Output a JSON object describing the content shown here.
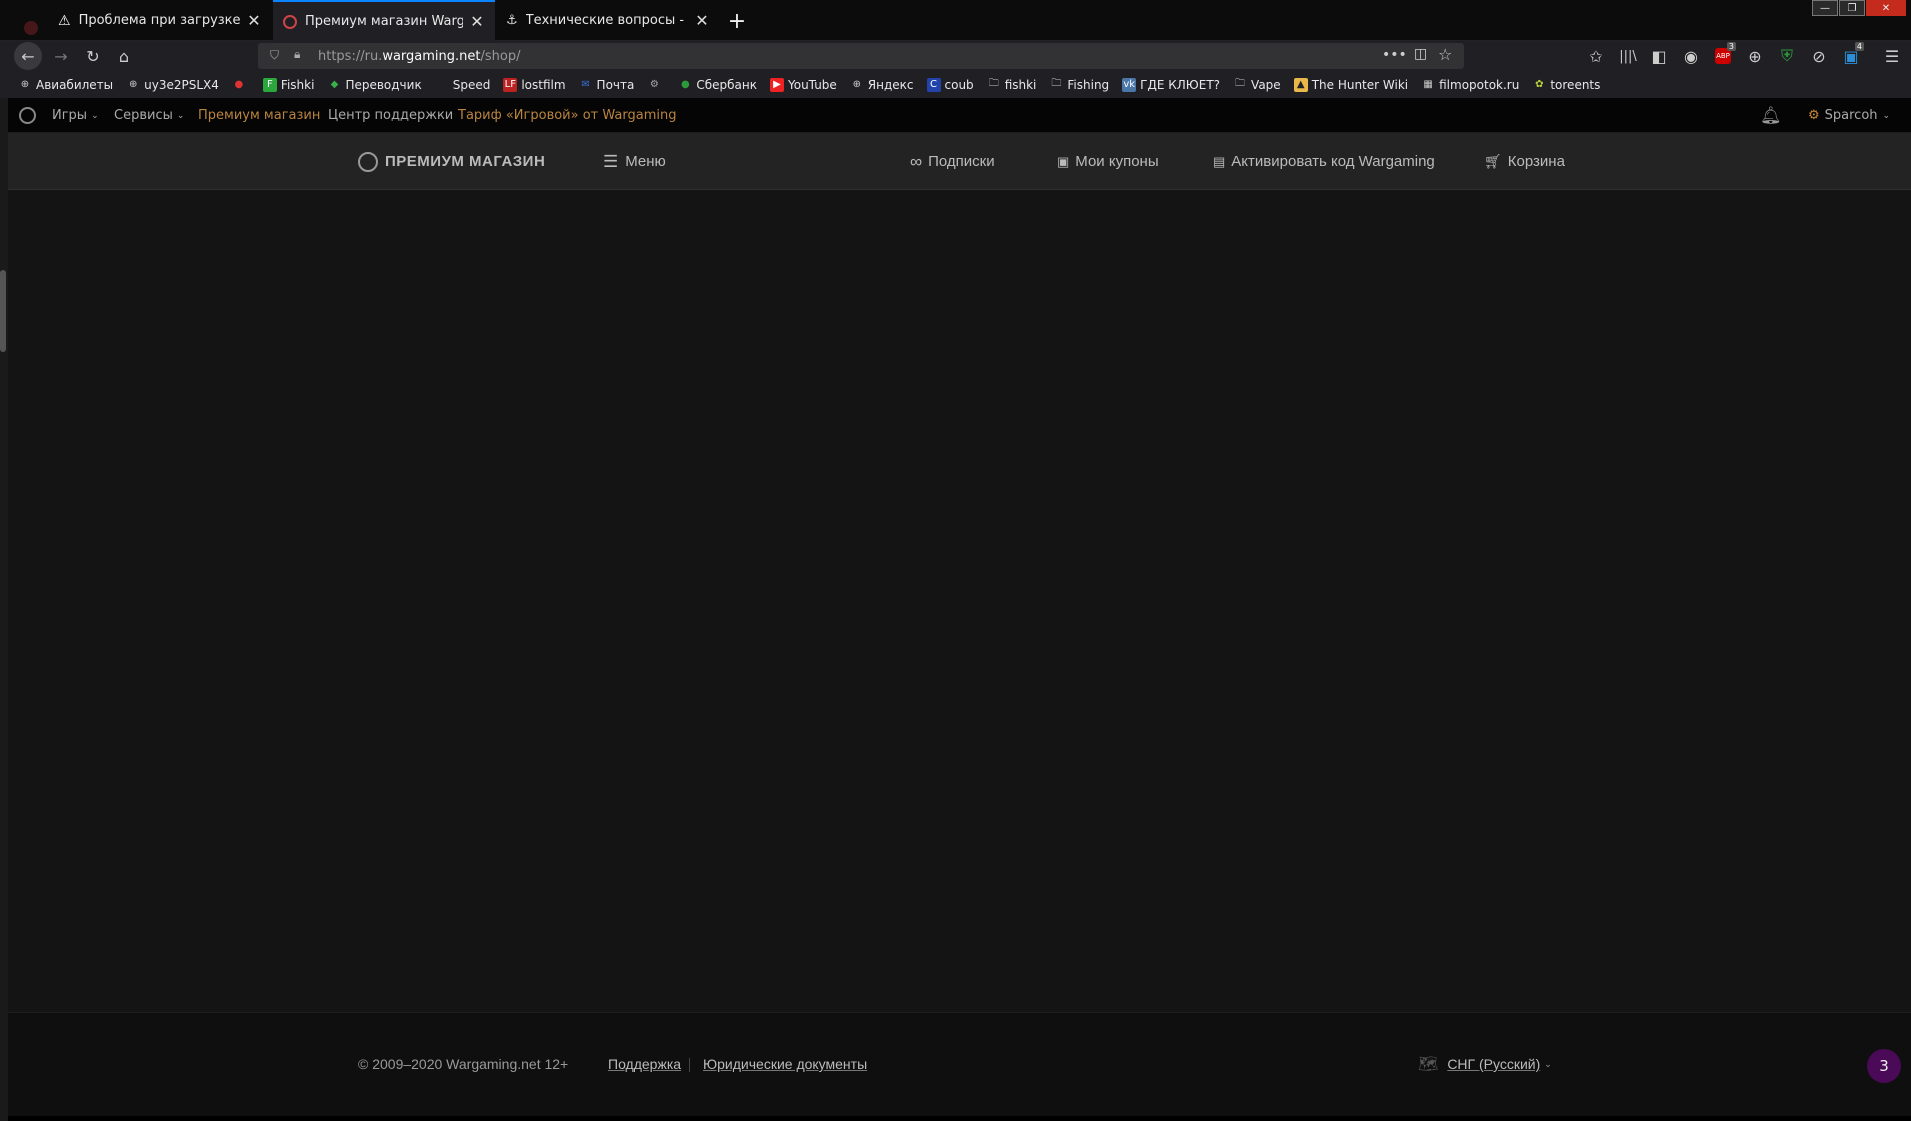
{
  "browser": {
    "tabs": [
      {
        "title": "Проблема при загрузке стра",
        "icon": "warning-icon",
        "active": false
      },
      {
        "title": "Премиум магазин Wargaming",
        "icon": "wargaming-logo-icon",
        "active": true
      },
      {
        "title": "Технические вопросы - Офи",
        "icon": "warships-icon",
        "active": false
      }
    ],
    "new_tab": "+",
    "url_prefix": "https://ru.",
    "url_domain": "wargaming.net",
    "url_path": "/shop/",
    "toolbar_badges": {
      "abp": "3",
      "ext": "4"
    },
    "bookmarks": [
      {
        "label": "Авиабилеты",
        "icon": "globe-icon"
      },
      {
        "label": "uy3e2PSLX4",
        "icon": "globe-icon"
      },
      {
        "label": "",
        "icon": "russia-flag-icon"
      },
      {
        "label": "Fishki",
        "icon": "fishki-icon"
      },
      {
        "label": "Переводчик",
        "icon": "translate-icon"
      },
      {
        "label": "Speed",
        "icon": "speed-icon"
      },
      {
        "label": "lostfilm",
        "icon": "lostfilm-icon"
      },
      {
        "label": "Почта",
        "icon": "mail-icon"
      },
      {
        "label": "",
        "icon": "wot-icon"
      },
      {
        "label": "Сбербанк",
        "icon": "sberbank-icon"
      },
      {
        "label": "YouTube",
        "icon": "youtube-icon"
      },
      {
        "label": "Яндекс",
        "icon": "globe-icon"
      },
      {
        "label": "coub",
        "icon": "coub-icon"
      },
      {
        "label": "fishki",
        "icon": "folder-icon"
      },
      {
        "label": "Fishing",
        "icon": "folder-icon"
      },
      {
        "label": "ГДЕ КЛЮЕТ?",
        "icon": "vk-icon"
      },
      {
        "label": "Vape",
        "icon": "folder-icon"
      },
      {
        "label": "The Hunter Wiki",
        "icon": "hunter-icon"
      },
      {
        "label": "filmopotok.ru",
        "icon": "film-icon"
      },
      {
        "label": "toreents",
        "icon": "torrent-icon"
      }
    ]
  },
  "site": {
    "topnav": {
      "games": "Игры",
      "services": "Сервисы",
      "premium_shop": "Премиум магазин",
      "support_center": "Центр поддержки",
      "tariff": "Тариф «Игровой» от Wargaming",
      "user": "Sparcoh"
    },
    "shop": {
      "logo": "ПРЕМИУМ МАГАЗИН",
      "menu": "Меню",
      "subscriptions": "Подписки",
      "coupons": "Мои купоны",
      "activate_code": "Активировать код Wargaming",
      "cart": "Корзина"
    },
    "footer": {
      "copyright": "© 2009–2020 Wargaming.net 12+",
      "support": "Поддержка",
      "legal": "Юридические документы",
      "region": "СНГ (Русский)"
    },
    "notification_badge": "3"
  },
  "colors": {
    "accent": "#c7883a",
    "link_active": "#b9843f",
    "badge": "#4b0a57"
  }
}
